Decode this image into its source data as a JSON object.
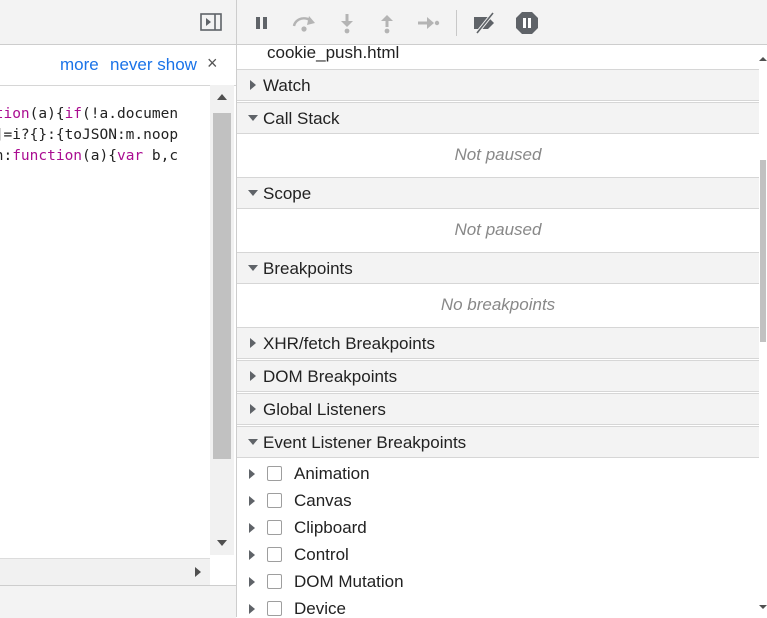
{
  "infobar": {
    "more_label": "more",
    "never_show_label": "never show",
    "close_symbol": "×"
  },
  "code_lines": [
    [
      {
        "t": "ction",
        "c": "kw"
      },
      {
        "t": "(a){",
        "c": "pl"
      },
      {
        "t": "if",
        "c": "kw"
      },
      {
        "t": "(!a.documen",
        "c": "pl"
      }
    ],
    [
      {
        "t": "k]=i?{}:{toJSON:m.noop",
        "c": "pl"
      }
    ],
    [
      {
        "t": "un:",
        "c": "pl"
      },
      {
        "t": "function",
        "c": "kw"
      },
      {
        "t": "(a){",
        "c": "pl"
      },
      {
        "t": "var",
        "c": "kw"
      },
      {
        "t": " b,c",
        "c": "pl"
      }
    ]
  ],
  "debugger": {
    "toolbar_icons": [
      "pause-icon",
      "step-over-icon",
      "step-into-icon",
      "step-out-icon",
      "step-icon",
      "deactivate-breakpoints-icon",
      "pause-on-exceptions-icon"
    ],
    "file_name": "cookie_push.html",
    "sections": {
      "watch": "Watch",
      "call_stack": "Call Stack",
      "call_stack_empty": "Not paused",
      "scope": "Scope",
      "scope_empty": "Not paused",
      "breakpoints": "Breakpoints",
      "breakpoints_empty": "No breakpoints",
      "xhr": "XHR/fetch Breakpoints",
      "dom": "DOM Breakpoints",
      "global": "Global Listeners",
      "event_listener": "Event Listener Breakpoints"
    },
    "event_categories": [
      "Animation",
      "Canvas",
      "Clipboard",
      "Control",
      "DOM Mutation",
      "Device"
    ]
  }
}
